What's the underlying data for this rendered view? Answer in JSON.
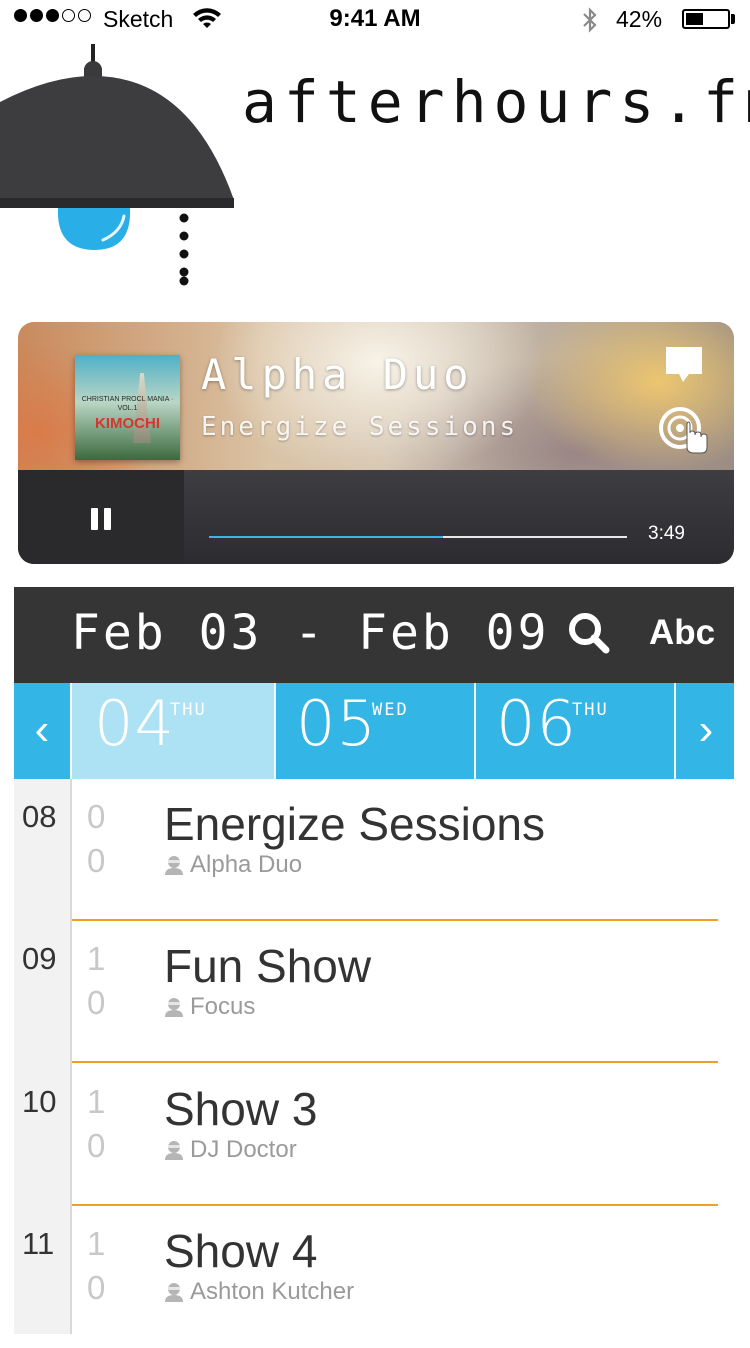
{
  "status_bar": {
    "carrier": "Sketch",
    "time": "9:41 AM",
    "battery": "42%"
  },
  "brand": {
    "title": "afterhours.fm",
    "accent_color": "#3db4e8"
  },
  "player": {
    "track_title": "Alpha Duo",
    "show_name": "Energize Sessions",
    "album_art": {
      "top_text": "CHRISTIAN PROCL MANIA · VOL.1",
      "title": "KIMOCHI"
    },
    "duration": "3:49",
    "progress_fraction": 0.56,
    "icons": [
      "chat-bubble-icon",
      "vinyl-touch-icon",
      "pause-icon"
    ]
  },
  "schedule": {
    "week_range": "Feb 03 - Feb 09",
    "search_icon": "search-icon",
    "sort_label": "Abc",
    "days": [
      {
        "number": "04",
        "name": "THU",
        "selected": true
      },
      {
        "number": "05",
        "name": "WED",
        "selected": false
      },
      {
        "number": "06",
        "name": "THU",
        "selected": false
      }
    ],
    "nav": {
      "prev": "‹",
      "next": "›"
    },
    "rows": [
      {
        "hour": "08",
        "minute_top": "0",
        "minute_bottom": "0",
        "title": "Energize Sessions",
        "host": "Alpha Duo"
      },
      {
        "hour": "09",
        "minute_top": "1",
        "minute_bottom": "0",
        "title": "Fun Show",
        "host": "Focus"
      },
      {
        "hour": "10",
        "minute_top": "1",
        "minute_bottom": "0",
        "title": "Show 3",
        "host": "DJ Doctor"
      },
      {
        "hour": "11",
        "minute_top": "1",
        "minute_bottom": "0",
        "title": "Show 4",
        "host": "Ashton Kutcher"
      }
    ]
  },
  "colors": {
    "day_strip": "#33b5e5",
    "day_selected": "#ade1f4",
    "divider": "#f0a020",
    "header_bar": "#353535"
  }
}
